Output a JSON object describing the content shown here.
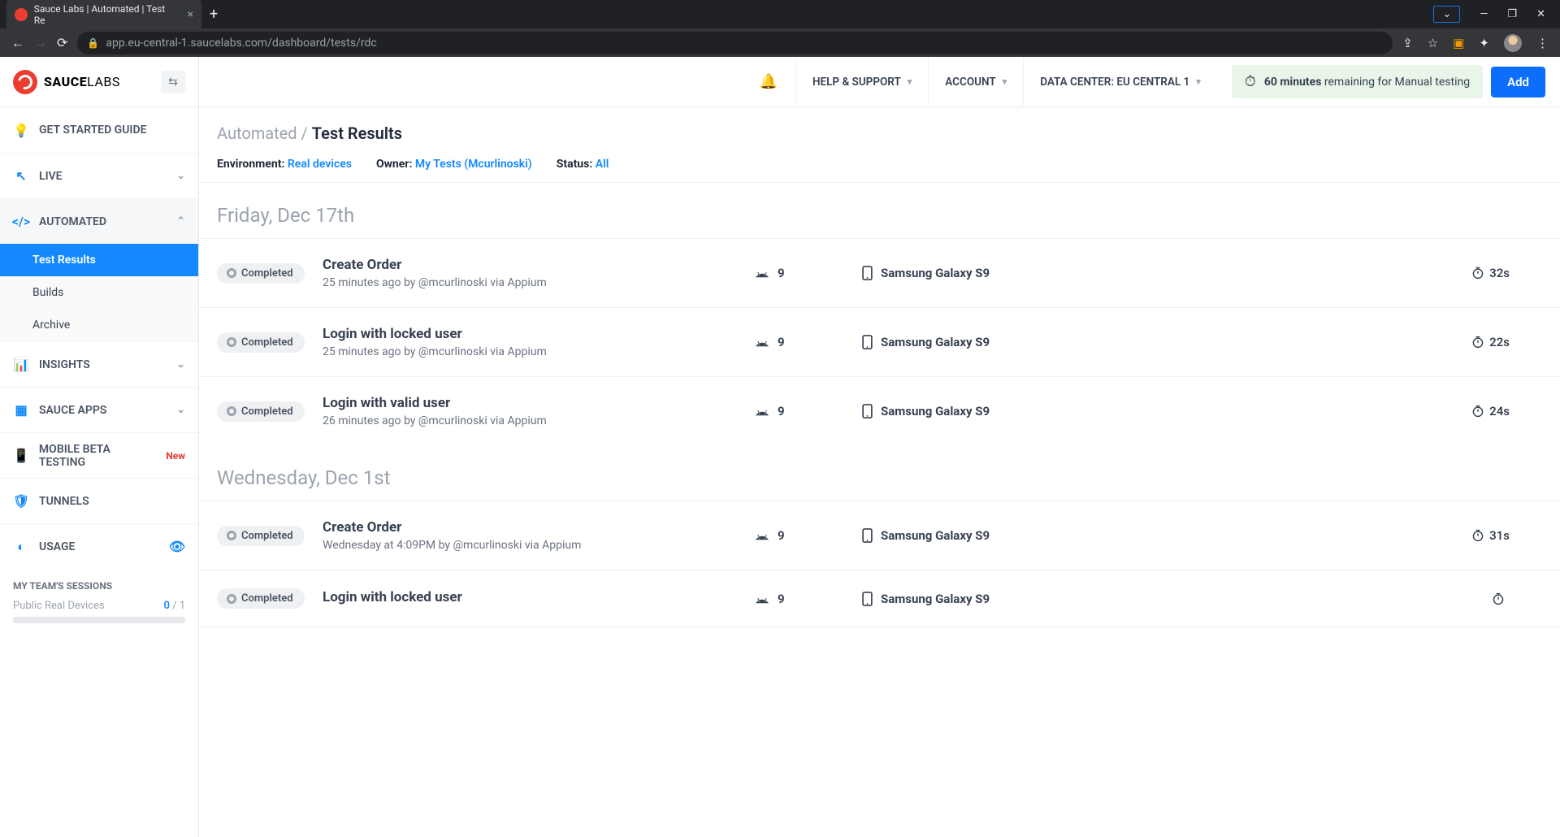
{
  "browser": {
    "tab_title": "Sauce Labs | Automated | Test Re",
    "url": "app.eu-central-1.saucelabs.com/dashboard/tests/rdc"
  },
  "logo": {
    "part1": "SAUCE",
    "part2": "LABS"
  },
  "sidebar": {
    "get_started": "GET STARTED GUIDE",
    "live": "LIVE",
    "automated": "AUTOMATED",
    "automated_children": {
      "test_results": "Test Results",
      "builds": "Builds",
      "archive": "Archive"
    },
    "insights": "INSIGHTS",
    "sauce_apps": "SAUCE APPS",
    "mobile_beta": "MOBILE BETA TESTING",
    "mobile_beta_badge": "New",
    "tunnels": "TUNNELS",
    "usage": "USAGE",
    "team_title": "MY TEAM'S SESSIONS",
    "team_label": "Public Real Devices",
    "team_used": "0",
    "team_total": " / 1"
  },
  "topbar": {
    "help": "HELP & SUPPORT",
    "account": "ACCOUNT",
    "datacenter": "DATA CENTER: EU CENTRAL 1",
    "minutes_num": "60 minutes",
    "minutes_txt": "remaining for Manual testing",
    "add": "Add"
  },
  "breadcrumb": {
    "parent": "Automated",
    "sep": " / ",
    "current": "Test Results"
  },
  "filters": {
    "env_lbl": "Environment: ",
    "env_val": "Real devices",
    "owner_lbl": "Owner: ",
    "owner_val": "My Tests (Mcurlinoski)",
    "status_lbl": "Status: ",
    "status_val": "All"
  },
  "groups": [
    {
      "date": "Friday, Dec 17th",
      "tests": [
        {
          "status": "Completed",
          "name": "Create Order",
          "meta": "25 minutes ago by @mcurlinoski via Appium",
          "os": "9",
          "device": "Samsung Galaxy S9",
          "dur": "32s"
        },
        {
          "status": "Completed",
          "name": "Login with locked user",
          "meta": "25 minutes ago by @mcurlinoski via Appium",
          "os": "9",
          "device": "Samsung Galaxy S9",
          "dur": "22s"
        },
        {
          "status": "Completed",
          "name": "Login with valid user",
          "meta": "26 minutes ago by @mcurlinoski via Appium",
          "os": "9",
          "device": "Samsung Galaxy S9",
          "dur": "24s"
        }
      ]
    },
    {
      "date": "Wednesday, Dec 1st",
      "tests": [
        {
          "status": "Completed",
          "name": "Create Order",
          "meta": "Wednesday at 4:09PM by @mcurlinoski via Appium",
          "os": "9",
          "device": "Samsung Galaxy S9",
          "dur": "31s"
        },
        {
          "status": "Completed",
          "name": "Login with locked user",
          "meta": "",
          "os": "9",
          "device": "Samsung Galaxy S9",
          "dur": ""
        }
      ]
    }
  ]
}
